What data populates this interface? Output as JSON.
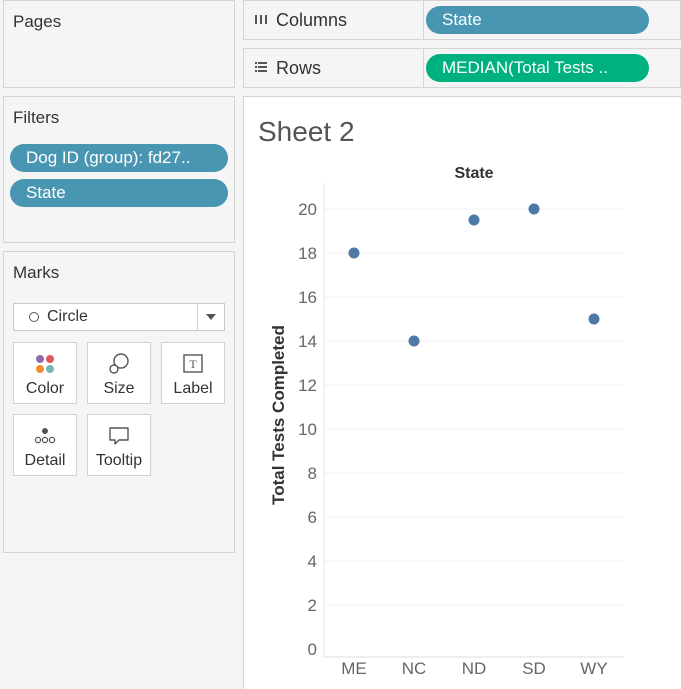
{
  "pages": {
    "title": "Pages"
  },
  "filters": {
    "title": "Filters",
    "items": [
      "Dog ID (group): fd27..",
      "State"
    ]
  },
  "marks": {
    "title": "Marks",
    "mark_type": "Circle",
    "buttons": [
      {
        "label": "Color",
        "icon": "color-icon"
      },
      {
        "label": "Size",
        "icon": "size-icon"
      },
      {
        "label": "Label",
        "icon": "label-icon"
      },
      {
        "label": "Detail",
        "icon": "detail-icon"
      },
      {
        "label": "Tooltip",
        "icon": "tooltip-icon"
      }
    ]
  },
  "shelves": {
    "columns": {
      "label": "Columns",
      "pill": "State"
    },
    "rows": {
      "label": "Rows",
      "pill": "MEDIAN(Total Tests .."
    }
  },
  "sheet": {
    "title": "Sheet 2"
  },
  "colors": {
    "dimension_pill": "#4996b2",
    "measure_pill": "#00b180",
    "mark": "#4e79a7"
  },
  "chart_data": {
    "type": "scatter",
    "header": "State",
    "categories": [
      "ME",
      "NC",
      "ND",
      "SD",
      "WY"
    ],
    "values": [
      18,
      14,
      19.5,
      20,
      15
    ],
    "ylabel": "Total Tests Completed",
    "ylim": [
      0,
      21
    ],
    "yticks": [
      0,
      2,
      4,
      6,
      8,
      10,
      12,
      14,
      16,
      18,
      20
    ],
    "grid": true
  }
}
